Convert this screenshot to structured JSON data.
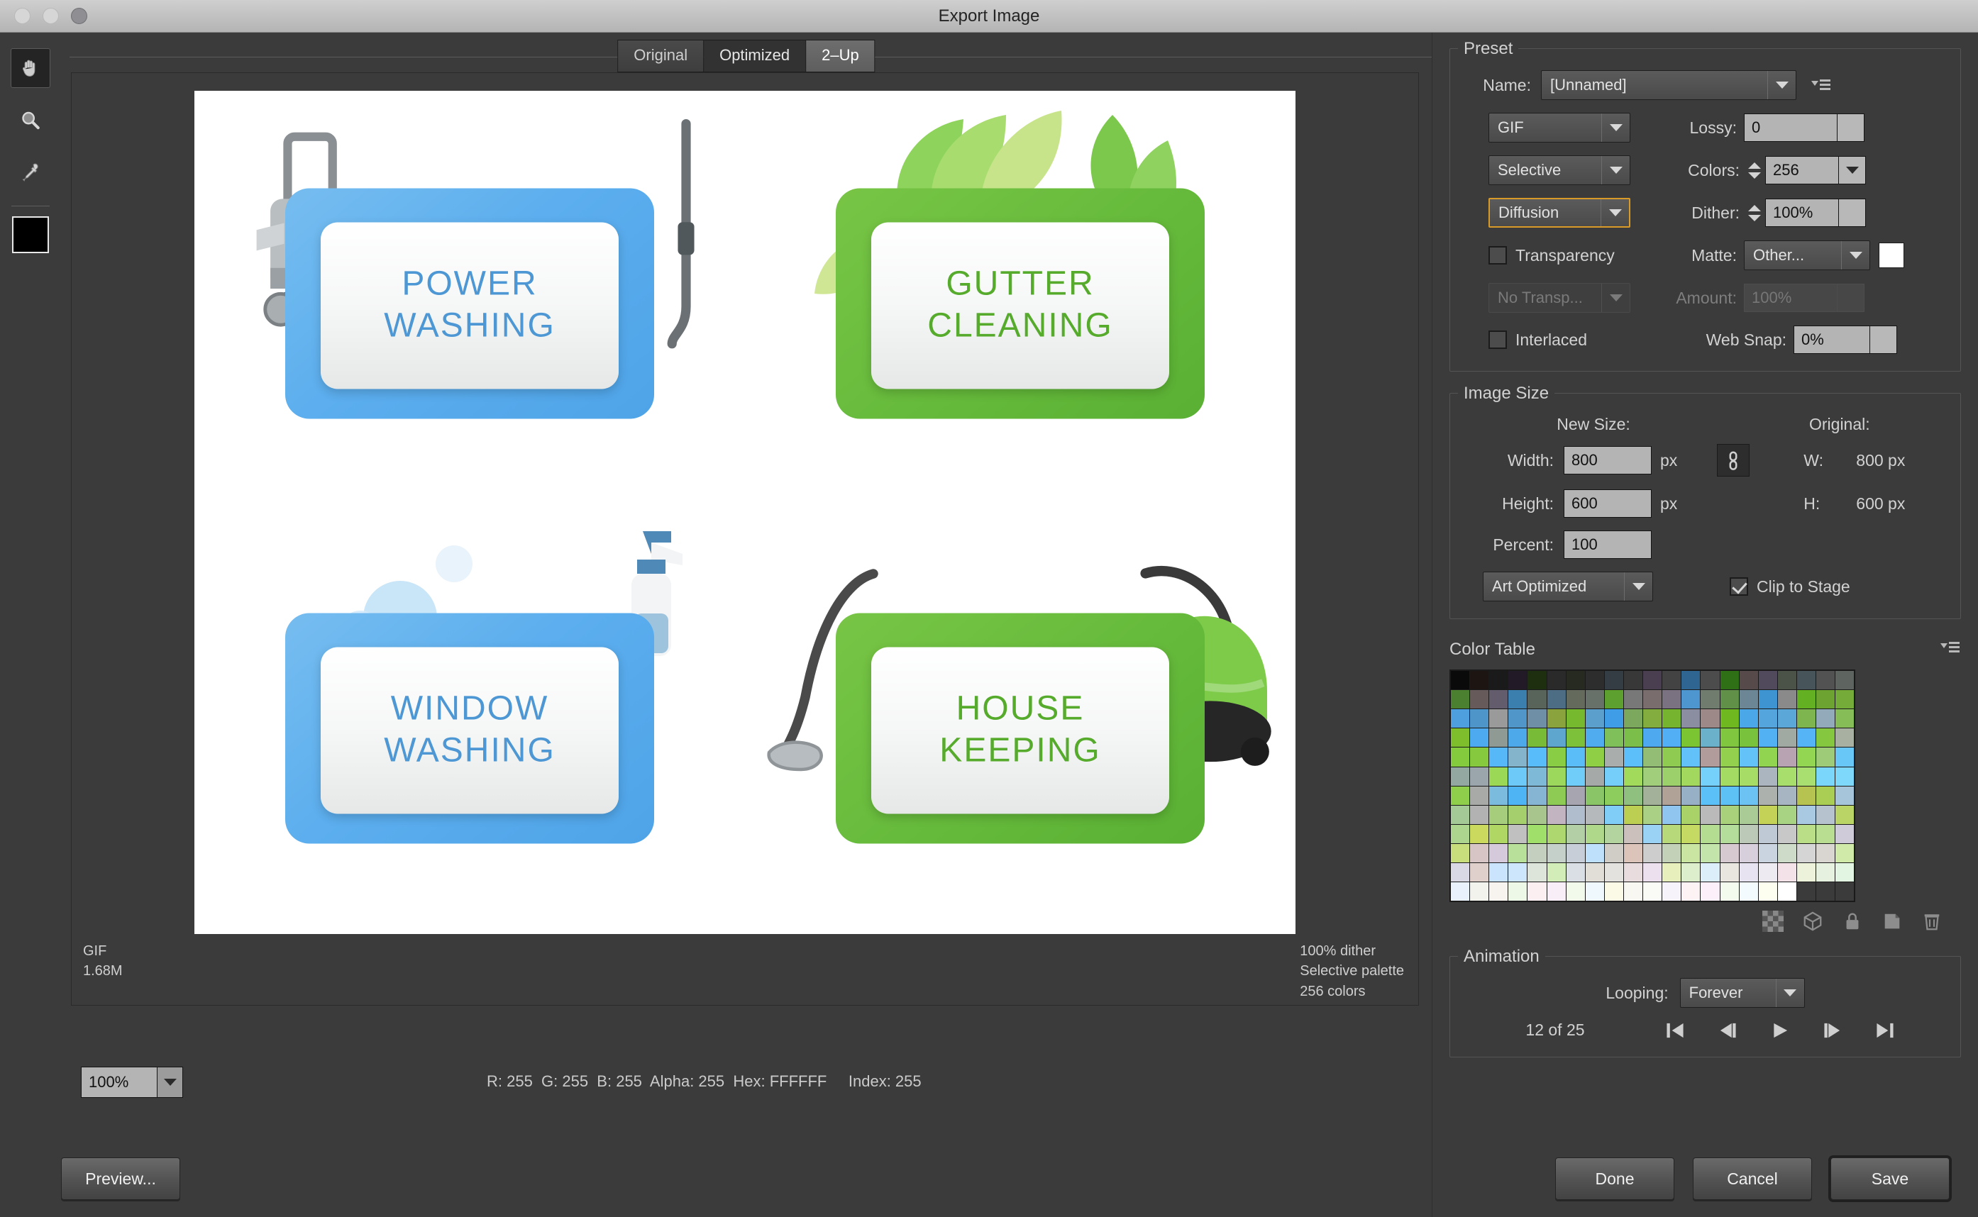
{
  "window": {
    "title": "Export Image",
    "traffic_lights": [
      "close",
      "minimize",
      "zoom"
    ]
  },
  "toolbar": {
    "tools": [
      {
        "name": "hand-tool",
        "selected": true
      },
      {
        "name": "zoom-tool",
        "selected": false
      },
      {
        "name": "eyedropper-tool",
        "selected": false
      }
    ],
    "foreground_color": "#000000"
  },
  "preview": {
    "tabs": [
      {
        "label": "Original",
        "selected": false
      },
      {
        "label": "Optimized",
        "selected": false
      },
      {
        "label": "2–Up",
        "selected": true
      }
    ],
    "status_left": [
      "GIF",
      "1.68M"
    ],
    "status_right": [
      "100% dither",
      "Selective palette",
      "256 colors"
    ],
    "tiles": [
      {
        "line1": "POWER",
        "line2": "WASHING",
        "color": "blue",
        "art": "pressure-washer"
      },
      {
        "line1": "GUTTER",
        "line2": "CLEANING",
        "color": "green",
        "art": "leaves"
      },
      {
        "line1": "WINDOW",
        "line2": "WASHING",
        "color": "blue",
        "art": "spray-bottle-bubbles"
      },
      {
        "line1": "HOUSE",
        "line2": "KEEPING",
        "color": "green",
        "art": "vacuum-cleaner"
      }
    ],
    "accent_blue": "#5caeee",
    "accent_green": "#67bb3c",
    "text_blue": "#4d97d4",
    "text_green": "#56ab2c"
  },
  "preset": {
    "legend": "Preset",
    "name_label": "Name:",
    "name_value": "[Unnamed]",
    "format_value": "GIF",
    "lossy_label": "Lossy:",
    "lossy_value": "0",
    "palette_value": "Selective",
    "colors_label": "Colors:",
    "colors_value": "256",
    "dither_algo_value": "Diffusion",
    "dither_label": "Dither:",
    "dither_value": "100%",
    "transparency_label": "Transparency",
    "transparency_checked": false,
    "matte_label": "Matte:",
    "matte_value": "Other...",
    "matte_color": "#ffffff",
    "transp_dither_value": "No Transp...",
    "amount_label": "Amount:",
    "amount_value": "100%",
    "interlaced_label": "Interlaced",
    "interlaced_checked": false,
    "websnap_label": "Web Snap:",
    "websnap_value": "0%"
  },
  "image_size": {
    "legend": "Image Size",
    "new_size_label": "New Size:",
    "original_label": "Original:",
    "width_label": "Width:",
    "width_value": "800",
    "width_unit": "px",
    "height_label": "Height:",
    "height_value": "600",
    "height_unit": "px",
    "percent_label": "Percent:",
    "percent_value": "100",
    "orig_w_label": "W:",
    "orig_w_value": "800 px",
    "orig_h_label": "H:",
    "orig_h_value": "600 px",
    "quality_value": "Art Optimized",
    "clip_label": "Clip to Stage",
    "clip_checked": true,
    "link_icon": "chain-link-icon"
  },
  "color_table": {
    "legend": "Color Table",
    "total_slots": 256,
    "columns": 21,
    "tools": [
      "transparency-icon",
      "web-shift-icon",
      "lock-icon",
      "new-color-icon",
      "delete-icon"
    ],
    "swatches": [
      "#0a0a0a",
      "#1c1512",
      "#1a1a1a",
      "#231a27",
      "#1d2f0f",
      "#2a2a2a",
      "#262a21",
      "#2d2d2d",
      "#343d44",
      "#383838",
      "#4a3f50",
      "#434343",
      "#2f6691",
      "#4c4c4c",
      "#2f6f16",
      "#564a4a",
      "#514a5c",
      "#4b5349",
      "#47545a",
      "#525252",
      "#5e6560",
      "#4a8030",
      "#665a5a",
      "#625c6d",
      "#3a7fae",
      "#58645a",
      "#4d6d85",
      "#646b5d",
      "#68706a",
      "#5da02f",
      "#787878",
      "#7a6d6e",
      "#7a7280",
      "#4e96cf",
      "#6f7c6e",
      "#619049",
      "#6d8695",
      "#3e93d1",
      "#8a8a8a",
      "#63b022",
      "#6da330",
      "#74ab39",
      "#4da0dd",
      "#4e95c9",
      "#9a9a9a",
      "#5196c9",
      "#6e8fa6",
      "#8aa33d",
      "#76b82e",
      "#5ba0cd",
      "#3f9ce6",
      "#7ba85d",
      "#84ad3f",
      "#76b430",
      "#8b8da0",
      "#9d8a88",
      "#6fb81f",
      "#4ba7e7",
      "#54a5de",
      "#5ba8d8",
      "#7eb54f",
      "#93aabb",
      "#86bd57",
      "#7ebd2b",
      "#4eaaf0",
      "#909a94",
      "#4ea9ea",
      "#77bb36",
      "#5fa6cf",
      "#7dc03a",
      "#50abef",
      "#7fc05b",
      "#7bbe4a",
      "#4fa9ef",
      "#52aff5",
      "#7bc432",
      "#6bb1c9",
      "#80c63e",
      "#79c23c",
      "#52b1f2",
      "#a1a9a3",
      "#54b4f6",
      "#85c83f",
      "#a7b0a1",
      "#84cb3d",
      "#86c93f",
      "#56b8f7",
      "#84b4cb",
      "#58bbfa",
      "#88cd44",
      "#5bbdf8",
      "#8fcf45",
      "#a9aeac",
      "#5dbff9",
      "#93bd74",
      "#8ecb50",
      "#62c1f8",
      "#b19c9b",
      "#92d04e",
      "#63c3f8",
      "#91d44f",
      "#b8a3b3",
      "#93d651",
      "#9ecb77",
      "#68c7f7",
      "#93a8a0",
      "#9aa6ab",
      "#9bd856",
      "#6dcaf8",
      "#7fb9d8",
      "#9bd85c",
      "#70ccf8",
      "#a5a9a7",
      "#74cef9",
      "#a2da5c",
      "#a0ce7b",
      "#9cd06a",
      "#a2d85e",
      "#76d1fa",
      "#a4db63",
      "#a7dd67",
      "#abb5bf",
      "#a8de6b",
      "#a9de70",
      "#7ad6fb",
      "#7dd8fb",
      "#8ece4a",
      "#a7aaa7",
      "#7bbbdd",
      "#4eb4f4",
      "#85b5d3",
      "#8ecb55",
      "#a6a5b0",
      "#8ac668",
      "#8dcd5d",
      "#8fc07f",
      "#a3b09a",
      "#b0a297",
      "#98b0c6",
      "#5cc0f8",
      "#5ec1f6",
      "#6cc2f2",
      "#adb1ae",
      "#a7b5c2",
      "#b6c350",
      "#a9ce53",
      "#a6c4da",
      "#a4c997",
      "#b2b2b2",
      "#a6cd7c",
      "#a5cf6c",
      "#a7c58d",
      "#c3b4c1",
      "#b0bdcc",
      "#b5b9bb",
      "#80cdf8",
      "#bccf52",
      "#a9d084",
      "#8fc5ef",
      "#a9d369",
      "#bababa",
      "#a9d17b",
      "#abcb96",
      "#c4d258",
      "#a8d383",
      "#a9c8e2",
      "#b6c3cf",
      "#bad565",
      "#aed58d",
      "#ccd95f",
      "#b0d664",
      "#c0c0c0",
      "#9fdf6a",
      "#aed76f",
      "#b3cfa5",
      "#b0d88b",
      "#b4d49f",
      "#cbc0bb",
      "#9ad2f6",
      "#b8d97a",
      "#c5da63",
      "#b4dd91",
      "#b4dc9a",
      "#bdc9b8",
      "#bfc9d6",
      "#c8c8c8",
      "#bade88",
      "#b9de92",
      "#cfcbd8",
      "#c8dd7c",
      "#d6c5c4",
      "#d4cadb",
      "#b9e09b",
      "#c5cfc0",
      "#c5d0ca",
      "#c7ced7",
      "#bfe0fb",
      "#d0ccc6",
      "#dcc4bb",
      "#cdcdcd",
      "#c3d1b8",
      "#cae5a1",
      "#c3e4ab",
      "#d6c9d0",
      "#d7cfdc",
      "#cad3e0",
      "#cedbc9",
      "#d5d5d5",
      "#d9d5d1",
      "#cfeaa9",
      "#d8d9e4",
      "#e0d0cb",
      "#c9e4fc",
      "#cde6fc",
      "#dde5da",
      "#d3edb8",
      "#dadfe5",
      "#e0ded6",
      "#e4e2df",
      "#e9dcdf",
      "#ece0ef",
      "#e7f0bd",
      "#ddeecd",
      "#ddeefb",
      "#e9e6e0",
      "#e7e3f0",
      "#eeeaf1",
      "#f3e2e8",
      "#edf2da",
      "#e6f1e0",
      "#e2f4e2",
      "#e9f1fd",
      "#f3f3ee",
      "#f7f3ef",
      "#eef8e6",
      "#fbeff2",
      "#f8eef8",
      "#f2fbeb",
      "#eef8fd",
      "#fbfae6",
      "#f8f7f2",
      "#fafaf7",
      "#f7f3fb",
      "#fdf2f4",
      "#fcf1fb",
      "#f3fbef",
      "#f4fbfe",
      "#fdfdf0",
      "#ffffff"
    ]
  },
  "animation": {
    "legend": "Animation",
    "looping_label": "Looping:",
    "looping_value": "Forever",
    "frame_counter": "12 of 25",
    "controls": [
      "first-frame-icon",
      "previous-frame-icon",
      "play-icon",
      "next-frame-icon",
      "last-frame-icon"
    ]
  },
  "bottom": {
    "zoom_value": "100%",
    "pixel_info": "R: 255  G: 255  B: 255  Alpha: 255  Hex: FFFFFF     Index: 255"
  },
  "footer": {
    "preview_label": "Preview...",
    "done_label": "Done",
    "cancel_label": "Cancel",
    "save_label": "Save"
  }
}
